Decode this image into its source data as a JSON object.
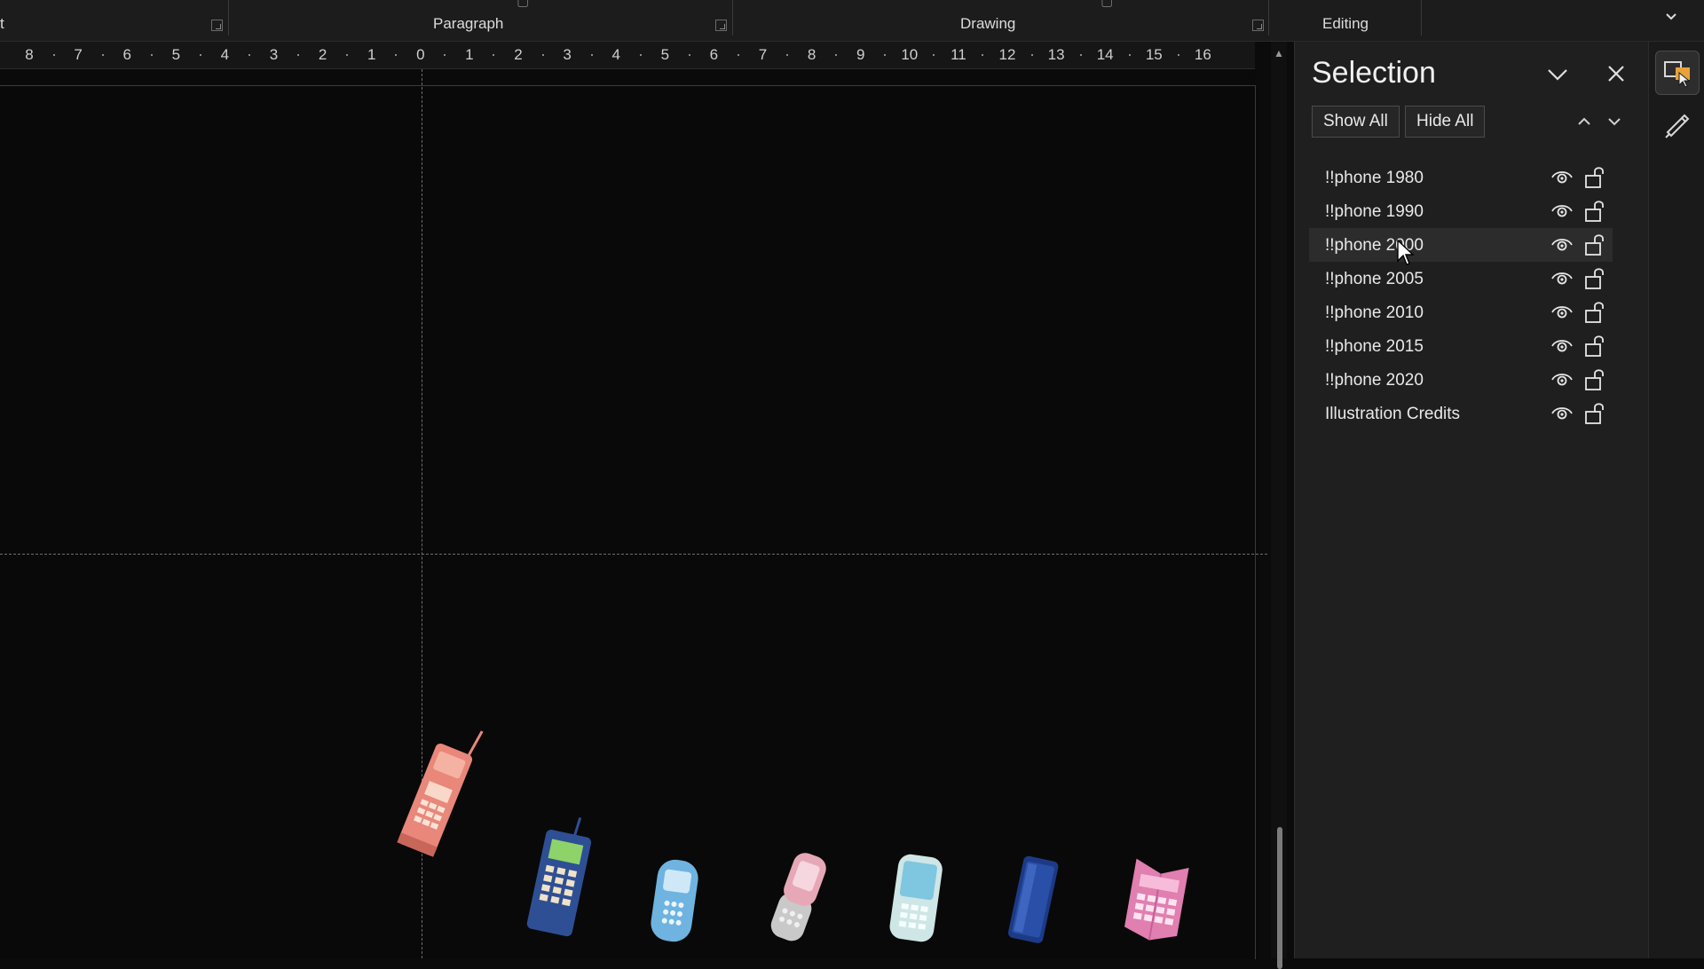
{
  "ribbon": {
    "groups": [
      {
        "label": "t"
      },
      {
        "label": "Paragraph"
      },
      {
        "label": "Drawing"
      },
      {
        "label": "Editing"
      }
    ],
    "collapse_icon": "chevron-down-icon"
  },
  "ruler": {
    "labels": [
      "8",
      "7",
      "6",
      "5",
      "4",
      "3",
      "2",
      "1",
      "0",
      "1",
      "2",
      "3",
      "4",
      "5",
      "6",
      "7",
      "8",
      "9",
      "10",
      "11",
      "12",
      "13",
      "14",
      "15",
      "16"
    ]
  },
  "canvas": {
    "phones": [
      {
        "era": "1980",
        "icon": "brick-phone-icon",
        "color": "#e8877a"
      },
      {
        "era": "1990",
        "icon": "bar-phone-icon",
        "color": "#2e4f93"
      },
      {
        "era": "2000",
        "icon": "candybar-phone-icon",
        "color": "#6fb3e0"
      },
      {
        "era": "2005",
        "icon": "slider-phone-icon",
        "color": "#e6a8b6"
      },
      {
        "era": "2010",
        "icon": "smartphone-icon",
        "color": "#cfe6e6"
      },
      {
        "era": "2015",
        "icon": "slim-phone-icon",
        "color": "#2a4fa8"
      },
      {
        "era": "2020",
        "icon": "foldable-phone-icon",
        "color": "#e07fb0"
      }
    ]
  },
  "selection_pane": {
    "title": "Selection",
    "show_all": "Show All",
    "hide_all": "Hide All",
    "items": [
      {
        "label": "!!phone 1980"
      },
      {
        "label": "!!phone 1990"
      },
      {
        "label": "!!phone 2000"
      },
      {
        "label": "!!phone 2005"
      },
      {
        "label": "!!phone 2010"
      },
      {
        "label": "!!phone 2015"
      },
      {
        "label": "!!phone 2020"
      },
      {
        "label": "Illustration Credits"
      }
    ]
  },
  "colors": {
    "accent": "#e8a23a",
    "pane_bg": "#1f1f1f",
    "canvas_bg": "#090909"
  }
}
